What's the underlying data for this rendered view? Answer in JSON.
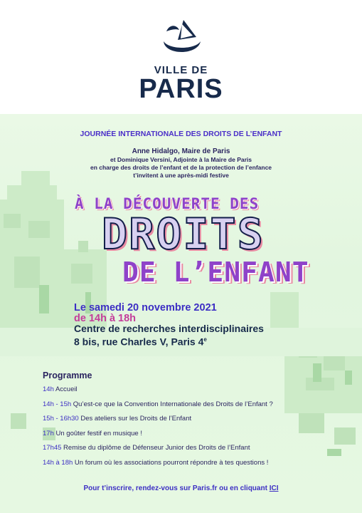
{
  "logo": {
    "small": "VILLE DE",
    "big": "PARIS"
  },
  "event": {
    "heading": "JOURNÉE INTERNATIONALE DES DROITS DE L’ENFANT",
    "invite_line1": "Anne Hidalgo, Maire de Paris",
    "invite_line2": "et Dominique Versini, Adjointe à la Maire de Paris",
    "invite_line3": "en charge des droits de l’enfant et de la protection de l’enfance",
    "invite_line4": "t’invitent à une après-midi festive",
    "title_line1": "À LA DÉCOUVERTE DES",
    "title_line2": "DROITS",
    "title_line3": "DE L’ENFANT",
    "date": "Le samedi 20 novembre 2021",
    "time": "de 14h à 18h",
    "venue": "Centre de recherches interdisciplinaires",
    "address": "8 bis, rue Charles V, Paris 4",
    "address_sup": "e"
  },
  "programme": {
    "title": "Programme",
    "items": [
      {
        "time": "14h",
        "text": " Accueil"
      },
      {
        "time": "14h - 15h",
        "text": " Qu’est-ce que la Convention Internationale des Droits de l’Enfant ?"
      },
      {
        "time": "15h - 16h30",
        "text": " Des ateliers sur les Droits de l’Enfant"
      },
      {
        "time": "17h",
        "text": " Un goûter festif en musique !"
      },
      {
        "time": "17h45",
        "text": " Remise du diplôme de Défenseur Junior des Droits de l’Enfant"
      },
      {
        "time": "14h à 18h",
        "text": " Un forum où les associations pourront répondre à tes questions !"
      }
    ]
  },
  "footer": {
    "text": "Pour t’inscrire, rendez-vous sur Paris.fr ou en cliquant ",
    "link": "ICI"
  },
  "colors": {
    "navy": "#172a4b",
    "violet": "#3c2ec4",
    "magenta": "#c43c9a",
    "background": "#e4f7e0"
  }
}
